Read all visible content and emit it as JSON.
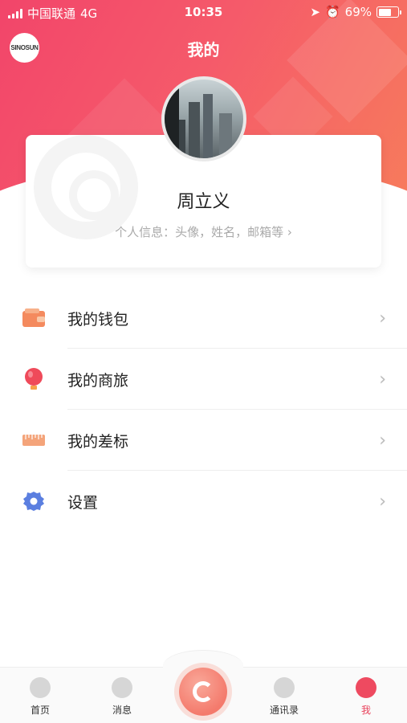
{
  "status_bar": {
    "carrier": "中国联通",
    "network": "4G",
    "time": "10:35",
    "battery": "69%",
    "battery_level": 0.69
  },
  "header": {
    "logo_text": "SINOSUN",
    "title": "我的"
  },
  "profile": {
    "name": "周立义",
    "info": "个人信息：头像，姓名，邮箱等 ›"
  },
  "menu": {
    "items": [
      {
        "label": "我的钱包",
        "icon": "wallet-icon",
        "color": "#f48a5e"
      },
      {
        "label": "我的商旅",
        "icon": "balloon-icon",
        "color": "#ef4a5a"
      },
      {
        "label": "我的差标",
        "icon": "ruler-icon",
        "color": "#f4a47a"
      },
      {
        "label": "设置",
        "icon": "gear-icon",
        "color": "#5b7fe0"
      }
    ]
  },
  "tabbar": {
    "tabs": [
      {
        "label": "首页"
      },
      {
        "label": "消息"
      },
      {
        "label": "通讯录"
      },
      {
        "label": "我"
      }
    ],
    "active_tab": "我"
  },
  "colors": {
    "accent": "#ee4a60",
    "gradient_start": "#f2456a",
    "gradient_end": "#f77d5b"
  }
}
